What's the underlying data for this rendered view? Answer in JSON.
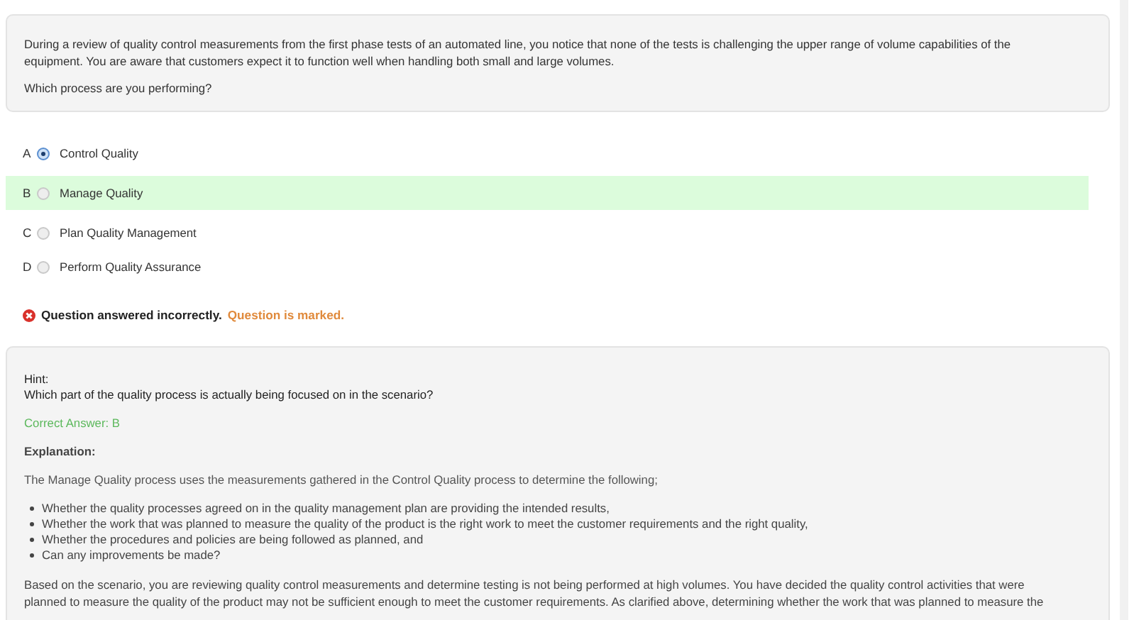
{
  "question": {
    "paragraphs": [
      "During a review of quality control measurements from the first phase tests of an automated line, you notice that none of the tests is challenging the upper range of volume capabilities of the equipment. You are aware that customers expect it to function well when handling both small and large volumes.",
      "Which process are you performing?"
    ]
  },
  "options": [
    {
      "letter": "A",
      "label": "Control Quality",
      "selected": true,
      "correct": false
    },
    {
      "letter": "B",
      "label": "Manage Quality",
      "selected": false,
      "correct": true
    },
    {
      "letter": "C",
      "label": "Plan Quality Management",
      "selected": false,
      "correct": false
    },
    {
      "letter": "D",
      "label": "Perform Quality Assurance",
      "selected": false,
      "correct": false
    }
  ],
  "result": {
    "message": "Question answered incorrectly.",
    "marked_text": "Question is marked."
  },
  "feedback": {
    "hint_label": "Hint:",
    "hint": "Which part of the quality process is actually being focused on in the scenario?",
    "correct_answer": "Correct Answer: B",
    "explanation_label": "Explanation:",
    "intro": "The Manage Quality process uses the measurements gathered in the Control Quality process to determine the following;",
    "bullets": [
      "Whether the quality processes agreed on in the quality management plan are providing the intended results,",
      "Whether the work that was planned to measure the quality of the product is the right work to meet the customer requirements and the right quality,",
      "Whether the procedures and policies are being followed as planned, and",
      "Can any improvements be made?"
    ],
    "conclusion": "Based on the scenario, you are reviewing quality control measurements and determine testing is not being performed at high volumes. You have decided the quality control activities that were planned to measure the quality of the product may not be sufficient enough to meet the customer requirements. As clarified above, determining whether the work that was planned to measure the"
  }
}
